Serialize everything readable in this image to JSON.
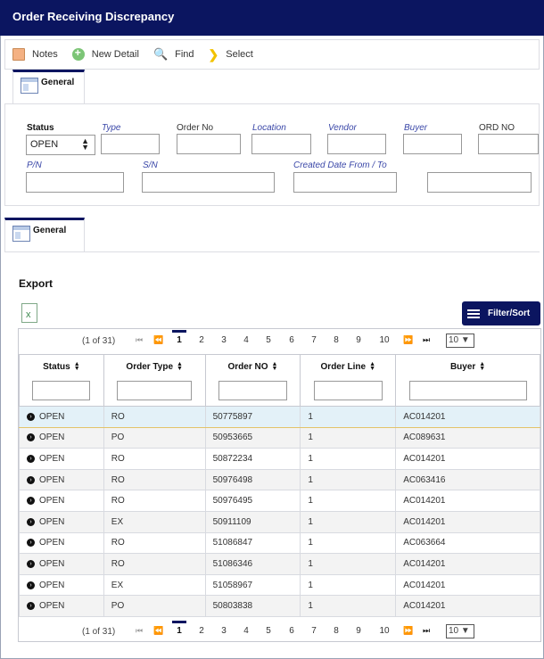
{
  "title": "Order Receiving Discrepancy",
  "toolbar": {
    "notes": "Notes",
    "new_detail": "New Detail",
    "find": "Find",
    "select": "Select"
  },
  "tabs": {
    "general_top": "General",
    "general_bottom": "General"
  },
  "filters": {
    "status_label": "Status",
    "status_value": "OPEN",
    "type_label": "Type",
    "order_no_label": "Order No",
    "location_label": "Location",
    "vendor_label": "Vendor",
    "buyer_label": "Buyer",
    "ord_no_label": "ORD NO",
    "pn_label": "P/N",
    "sn_label": "S/N",
    "created_label": "Created Date From / To"
  },
  "export_label": "Export",
  "filter_sort_label": "Filter/Sort",
  "pager": {
    "info": "(1 of 31)",
    "pages": [
      "1",
      "2",
      "3",
      "4",
      "5",
      "6",
      "7",
      "8",
      "9",
      "10"
    ],
    "per_page": "10"
  },
  "columns": [
    "Status",
    "Order Type",
    "Order NO",
    "Order Line",
    "Buyer"
  ],
  "rows": [
    [
      "OPEN",
      "RO",
      "50775897",
      "1",
      "AC014201"
    ],
    [
      "OPEN",
      "PO",
      "50953665",
      "1",
      "AC089631"
    ],
    [
      "OPEN",
      "RO",
      "50872234",
      "1",
      "AC014201"
    ],
    [
      "OPEN",
      "RO",
      "50976498",
      "1",
      "AC063416"
    ],
    [
      "OPEN",
      "RO",
      "50976495",
      "1",
      "AC014201"
    ],
    [
      "OPEN",
      "EX",
      "50911109",
      "1",
      "AC014201"
    ],
    [
      "OPEN",
      "RO",
      "51086847",
      "1",
      "AC063664"
    ],
    [
      "OPEN",
      "RO",
      "51086346",
      "1",
      "AC014201"
    ],
    [
      "OPEN",
      "EX",
      "51058967",
      "1",
      "AC014201"
    ],
    [
      "OPEN",
      "PO",
      "50803838",
      "1",
      "AC014201"
    ]
  ]
}
